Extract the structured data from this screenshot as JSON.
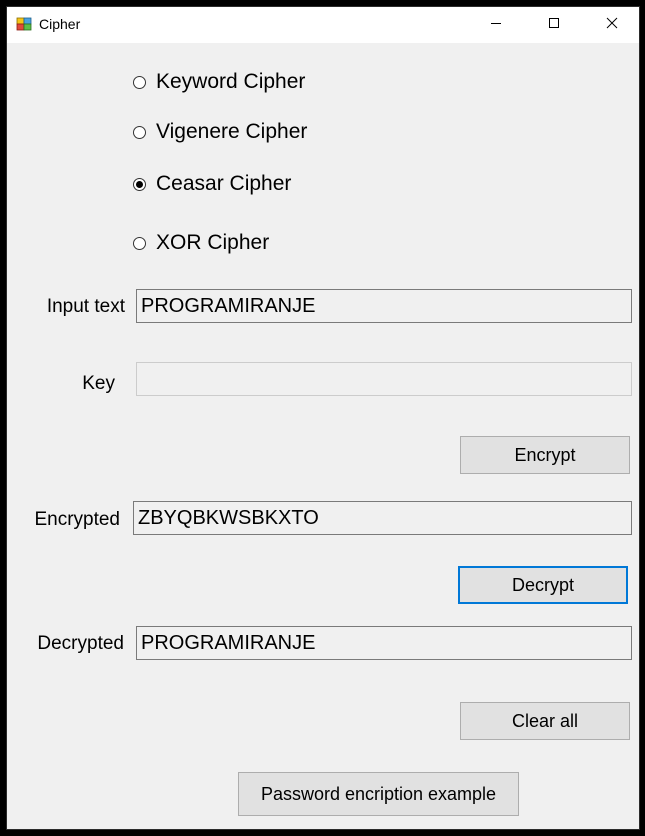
{
  "window": {
    "title": "Cipher"
  },
  "cipher_options": [
    {
      "label": "Keyword Cipher",
      "checked": false
    },
    {
      "label": "Vigenere Cipher",
      "checked": false
    },
    {
      "label": "Ceasar Cipher",
      "checked": true
    },
    {
      "label": "XOR Cipher",
      "checked": false
    }
  ],
  "form": {
    "input_label": "Input text",
    "input_value": "PROGRAMIRANJE",
    "key_label": "Key",
    "key_value": "",
    "encrypt_label": "Encrypt",
    "encrypted_label": "Encrypted",
    "encrypted_value": "ZBYQBKWSBKXTO",
    "decrypt_label": "Decrypt",
    "decrypted_label": "Decrypted",
    "decrypted_value": "PROGRAMIRANJE",
    "clear_label": "Clear all",
    "password_example_label": "Password encription example"
  },
  "colors": {
    "focus_accent": "#0078d7",
    "window_bg": "#f0f0f0",
    "button_bg": "#e1e1e1"
  },
  "icons": {
    "app": "app-icon",
    "minimize": "minimize-icon",
    "maximize": "maximize-icon",
    "close": "close-icon"
  }
}
